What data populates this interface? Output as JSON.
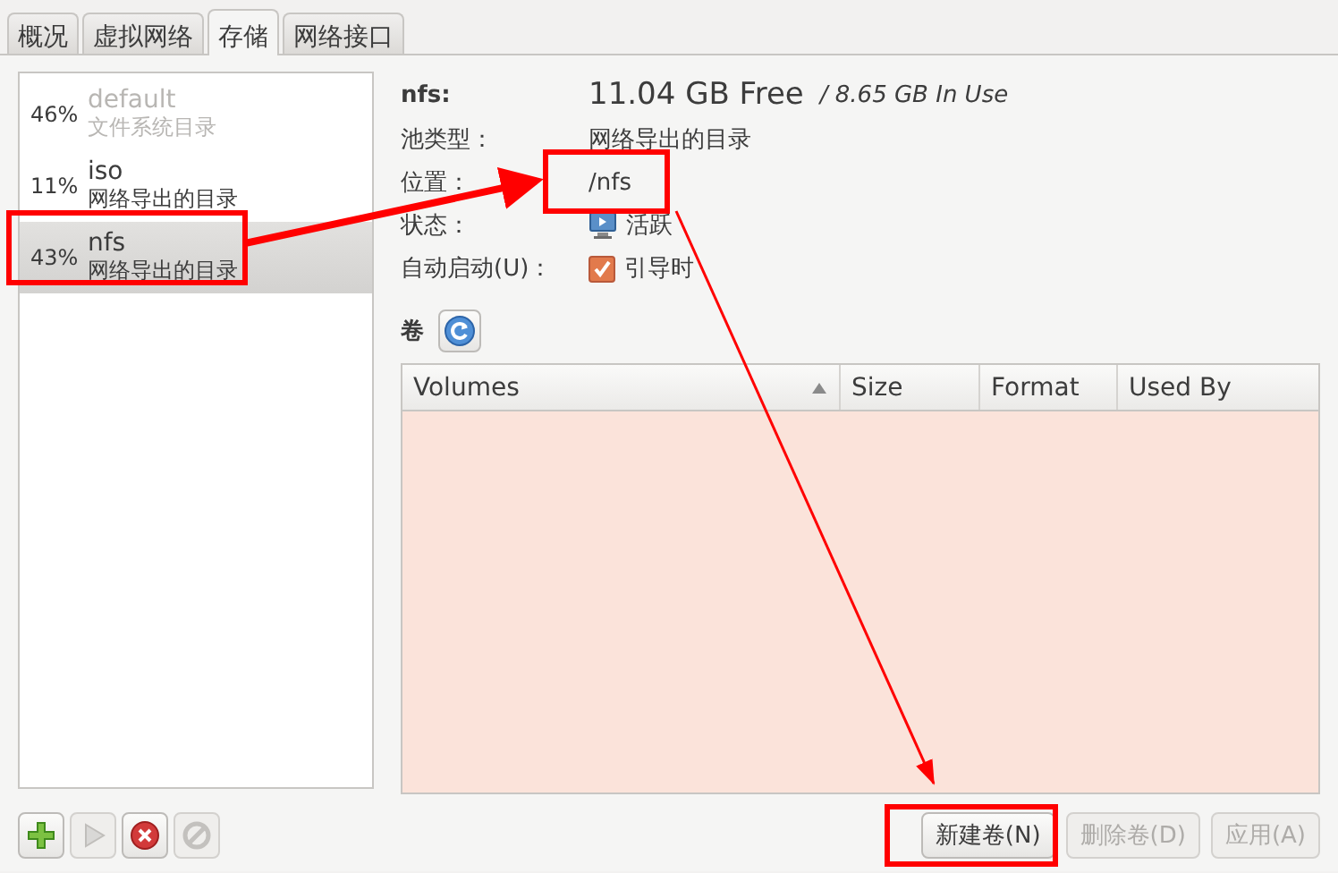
{
  "tabs": [
    {
      "label": "概况",
      "selected": false
    },
    {
      "label": "虚拟网络",
      "selected": false
    },
    {
      "label": "存储",
      "selected": true
    },
    {
      "label": "网络接口",
      "selected": false
    }
  ],
  "pools": [
    {
      "percent": "46%",
      "name": "default",
      "type": "文件系统目录",
      "active": false,
      "selected": false
    },
    {
      "percent": "11%",
      "name": "iso",
      "type": "网络导出的目录",
      "active": true,
      "selected": false
    },
    {
      "percent": "43%",
      "name": "nfs",
      "type": "网络导出的目录",
      "active": true,
      "selected": true
    }
  ],
  "details": {
    "name": "nfs:",
    "free": "11.04 GB Free",
    "in_use": "/ 8.65 GB In Use",
    "rows": [
      {
        "label": "池类型：",
        "value": "网络导出的目录",
        "kind": "text"
      },
      {
        "label": "位置：",
        "value": "/nfs",
        "kind": "text"
      },
      {
        "label": "状态：",
        "value": "活跃",
        "kind": "status"
      },
      {
        "label": "自动启动(U)：",
        "value": "引导时",
        "kind": "checkbox",
        "checked": true
      }
    ]
  },
  "volumes": {
    "label": "卷",
    "columns": [
      {
        "label": "Volumes",
        "sorted": true
      },
      {
        "label": "Size",
        "sorted": false
      },
      {
        "label": "Format",
        "sorted": false
      },
      {
        "label": "Used By",
        "sorted": false
      }
    ]
  },
  "pool_buttons": [
    {
      "kind": "add",
      "disabled": false
    },
    {
      "kind": "start",
      "disabled": true
    },
    {
      "kind": "delete",
      "disabled": false
    },
    {
      "kind": "stop",
      "disabled": true
    }
  ],
  "buttons": [
    {
      "label": "新建卷(N)",
      "disabled": false
    },
    {
      "label": "删除卷(D)",
      "disabled": true
    },
    {
      "label": "应用(A)",
      "disabled": true
    }
  ]
}
